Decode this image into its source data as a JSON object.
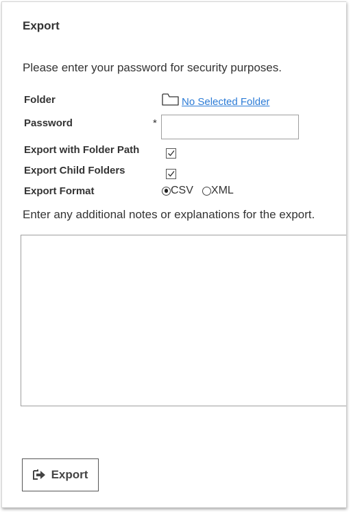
{
  "dialog": {
    "title": "Export",
    "intro": "Please enter your password for security purposes."
  },
  "form": {
    "folder_label": "Folder",
    "folder_link": "No Selected Folder",
    "password_label": "Password",
    "required_marker": "*",
    "password_value": "",
    "export_with_folder_path_label": "Export with Folder Path",
    "export_with_folder_path_checked": true,
    "export_child_folders_label": "Export Child Folders",
    "export_child_folders_checked": true,
    "export_format_label": "Export Format",
    "format_options": [
      {
        "label": "CSV",
        "selected": true
      },
      {
        "label": "XML",
        "selected": false
      }
    ],
    "notes_hint": "Enter any additional notes or explanations for the export.",
    "notes_value": ""
  },
  "actions": {
    "export_label": "Export",
    "export_icon": "sign-out-arrow-icon"
  },
  "colors": {
    "link": "#2b7bd6",
    "text": "#333333",
    "border": "#9e9e9e"
  }
}
